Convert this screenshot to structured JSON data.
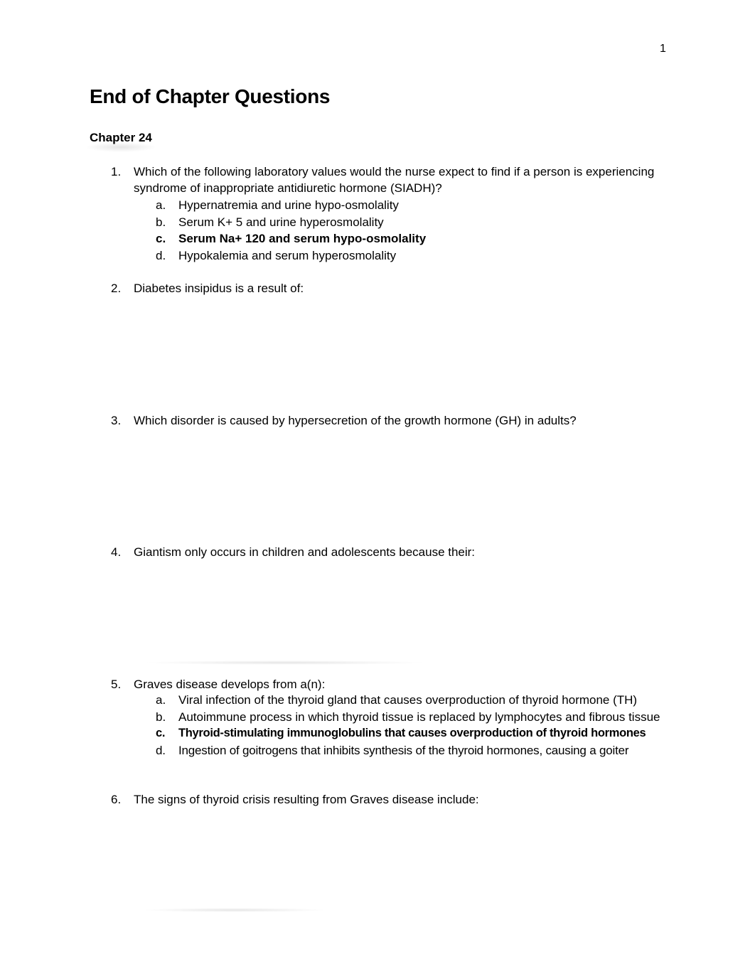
{
  "page_number": "1",
  "title": "End of Chapter Questions",
  "chapter": "Chapter 24",
  "questions": [
    {
      "number": "1.",
      "text": "Which of the following laboratory values would the nurse expect to find if a person is experiencing syndrome of inappropriate antidiuretic hormone (SIADH)?",
      "options": [
        {
          "letter": "a.",
          "text": "Hypernatremia and urine hypo-osmolality",
          "correct": false
        },
        {
          "letter": "b.",
          "text": "Serum K+ 5 and urine hyperosmolality",
          "correct": false
        },
        {
          "letter": "c.",
          "text": "Serum Na+ 120 and serum hypo-osmolality",
          "correct": true
        },
        {
          "letter": "d.",
          "text": "Hypokalemia and serum hyperosmolality",
          "correct": false
        }
      ]
    },
    {
      "number": "2.",
      "text": "Diabetes insipidus is a result of:",
      "options": []
    },
    {
      "number": "3.",
      "text": "Which disorder is caused by hypersecretion of the growth hormone (GH) in adults?",
      "options": []
    },
    {
      "number": "4.",
      "text": "Giantism only occurs in children and adolescents because their:",
      "options": []
    },
    {
      "number": "5.",
      "text": "Graves disease develops from a(n):",
      "options": [
        {
          "letter": "a.",
          "text": "Viral infection of the thyroid gland that causes overproduction of thyroid hormone (TH)",
          "correct": false
        },
        {
          "letter": "b.",
          "text": "Autoimmune process in which thyroid tissue is replaced by lymphocytes and fibrous tissue",
          "correct": false
        },
        {
          "letter": "c.",
          "text": "Thyroid-stimulating immunoglobulins that causes overproduction of thyroid hormones",
          "correct": true
        },
        {
          "letter": "d.",
          "text": "Ingestion of goitrogens that inhibits synthesis of the thyroid hormones, causing a goiter",
          "correct": false
        }
      ]
    },
    {
      "number": "6.",
      "text": "The signs of thyroid crisis resulting from Graves disease include:",
      "options": []
    }
  ]
}
